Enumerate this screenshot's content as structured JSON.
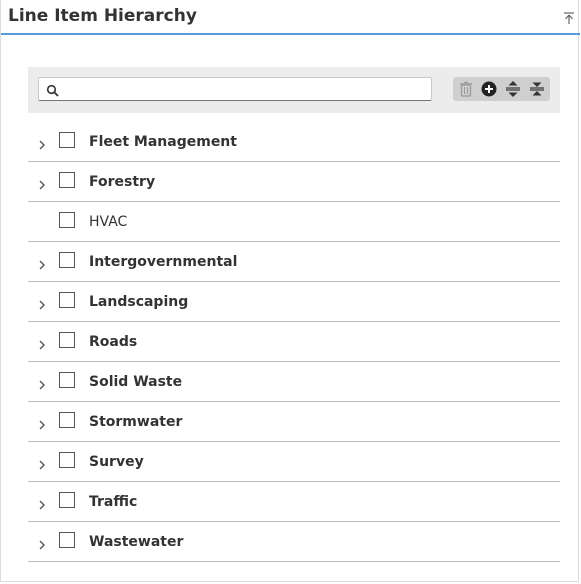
{
  "panel": {
    "title": "Line Item Hierarchy",
    "accent": "#5b9bd5"
  },
  "search": {
    "value": "",
    "placeholder": "",
    "icon": "search-icon"
  },
  "toolbar": {
    "buttons": [
      {
        "name": "delete",
        "icon": "trash-icon",
        "enabled": false
      },
      {
        "name": "add",
        "icon": "plus-circle-icon",
        "enabled": true
      },
      {
        "name": "expand-all",
        "icon": "expand-all-icon",
        "enabled": true
      },
      {
        "name": "collapse-all",
        "icon": "collapse-all-icon",
        "enabled": true
      }
    ]
  },
  "items": [
    {
      "label": "Fleet Management",
      "has_children": true,
      "checked": false
    },
    {
      "label": "Forestry",
      "has_children": true,
      "checked": false
    },
    {
      "label": "HVAC",
      "has_children": false,
      "checked": false
    },
    {
      "label": "Intergovernmental",
      "has_children": true,
      "checked": false
    },
    {
      "label": "Landscaping",
      "has_children": true,
      "checked": false
    },
    {
      "label": "Roads",
      "has_children": true,
      "checked": false
    },
    {
      "label": "Solid Waste",
      "has_children": true,
      "checked": false
    },
    {
      "label": "Stormwater",
      "has_children": true,
      "checked": false
    },
    {
      "label": "Survey",
      "has_children": true,
      "checked": false
    },
    {
      "label": "Traffic",
      "has_children": true,
      "checked": false
    },
    {
      "label": "Wastewater",
      "has_children": true,
      "checked": false
    }
  ]
}
